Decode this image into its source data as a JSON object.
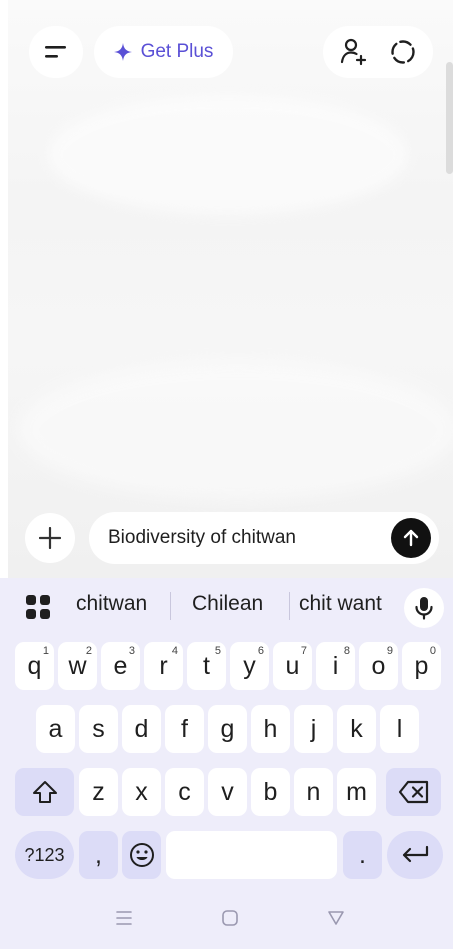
{
  "top_bar": {
    "get_plus_label": "Get Plus"
  },
  "composer": {
    "input_value": "Biodiversity of chitwan"
  },
  "keyboard": {
    "suggestions": [
      "chitwan",
      "Chilean",
      "chit want"
    ],
    "row1": [
      {
        "k": "q",
        "h": "1"
      },
      {
        "k": "w",
        "h": "2"
      },
      {
        "k": "e",
        "h": "3"
      },
      {
        "k": "r",
        "h": "4"
      },
      {
        "k": "t",
        "h": "5"
      },
      {
        "k": "y",
        "h": "6"
      },
      {
        "k": "u",
        "h": "7"
      },
      {
        "k": "i",
        "h": "8"
      },
      {
        "k": "o",
        "h": "9"
      },
      {
        "k": "p",
        "h": "0"
      }
    ],
    "row2": [
      "a",
      "s",
      "d",
      "f",
      "g",
      "h",
      "j",
      "k",
      "l"
    ],
    "row3": [
      "z",
      "x",
      "c",
      "v",
      "b",
      "n",
      "m"
    ],
    "symbols_label": "?123",
    "comma": ",",
    "period": "."
  },
  "colors": {
    "accent": "#5a50d6",
    "keyboard_bg": "#eeedfa",
    "modifier_key": "#dcdcf7"
  }
}
